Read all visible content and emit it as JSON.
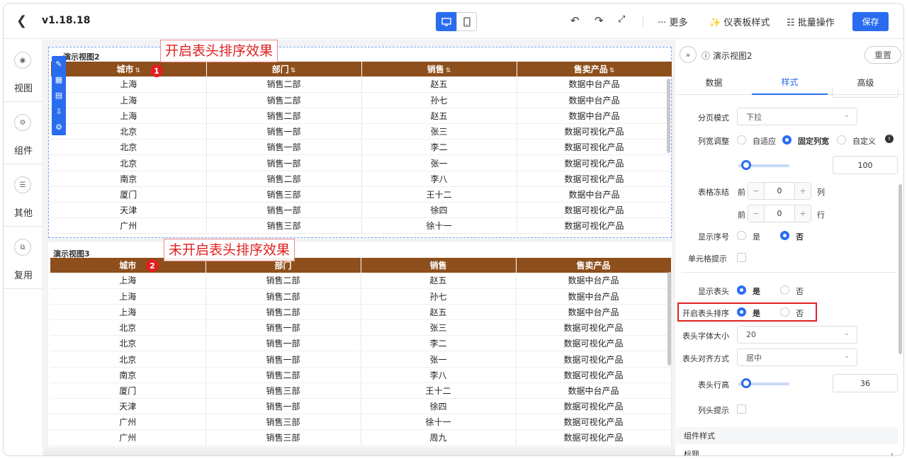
{
  "topbar": {
    "version": "v1.18.18",
    "more": "··· 更多",
    "dashboard_style": "仪表板样式",
    "batch_ops": "批量操作",
    "save": "保存"
  },
  "leftnav": {
    "items": [
      {
        "label": "视图"
      },
      {
        "label": "组件"
      },
      {
        "label": "其他"
      },
      {
        "label": "复用"
      }
    ]
  },
  "canvas": {
    "annotations": {
      "a1": "开启表头排序效果",
      "a2": "未开启表头排序效果",
      "n1": "1",
      "n2": "2"
    },
    "view1": {
      "title": "演示视图2",
      "columns": [
        "城市",
        "部门",
        "销售",
        "售卖产品"
      ],
      "sort_icon": "⇅",
      "rows": [
        [
          "上海",
          "销售二部",
          "赵五",
          "数据中台产品"
        ],
        [
          "上海",
          "销售二部",
          "孙七",
          "数据中台产品"
        ],
        [
          "上海",
          "销售二部",
          "赵五",
          "数据中台产品"
        ],
        [
          "北京",
          "销售一部",
          "张三",
          "数据可视化产品"
        ],
        [
          "北京",
          "销售一部",
          "李二",
          "数据可视化产品"
        ],
        [
          "北京",
          "销售一部",
          "张一",
          "数据可视化产品"
        ],
        [
          "南京",
          "销售二部",
          "李八",
          "数据可视化产品"
        ],
        [
          "厦门",
          "销售三部",
          "王十二",
          "数据中台产品"
        ],
        [
          "天津",
          "销售一部",
          "徐四",
          "数据可视化产品"
        ],
        [
          "广州",
          "销售三部",
          "徐十一",
          "数据可视化产品"
        ]
      ]
    },
    "view2": {
      "title": "演示视图3",
      "columns": [
        "城市",
        "部门",
        "销售",
        "售卖产品"
      ],
      "rows": [
        [
          "上海",
          "销售二部",
          "赵五",
          "数据中台产品"
        ],
        [
          "上海",
          "销售二部",
          "孙七",
          "数据中台产品"
        ],
        [
          "上海",
          "销售二部",
          "赵五",
          "数据中台产品"
        ],
        [
          "北京",
          "销售一部",
          "张三",
          "数据可视化产品"
        ],
        [
          "北京",
          "销售一部",
          "李二",
          "数据可视化产品"
        ],
        [
          "北京",
          "销售一部",
          "张一",
          "数据可视化产品"
        ],
        [
          "南京",
          "销售二部",
          "李八",
          "数据可视化产品"
        ],
        [
          "厦门",
          "销售三部",
          "王十二",
          "数据中台产品"
        ],
        [
          "天津",
          "销售一部",
          "徐四",
          "数据可视化产品"
        ],
        [
          "广州",
          "销售三部",
          "徐十一",
          "数据可视化产品"
        ],
        [
          "广州",
          "销售三部",
          "周九",
          "数据可视化产品"
        ]
      ]
    }
  },
  "rpanel": {
    "title": "演示视图2",
    "reset": "重置",
    "tabs": [
      "数据",
      "样式",
      "高级"
    ],
    "pagination_label": "分页模式",
    "pagination_value": "下拉",
    "colwidth_label": "列宽调整",
    "colwidth_options": [
      "自适应",
      "固定列宽",
      "自定义"
    ],
    "colwidth_value": "100",
    "freeze_label": "表格冻结",
    "freeze_before": "前",
    "freeze_col_value": "0",
    "freeze_col_unit": "列",
    "freeze_row_value": "0",
    "freeze_row_unit": "行",
    "show_index_label": "显示序号",
    "yes": "是",
    "no": "否",
    "cell_tip_label": "单元格提示",
    "show_header_label": "显示表头",
    "header_sort_label": "开启表头排序",
    "header_font_label": "表头字体大小",
    "header_font_value": "20",
    "header_align_label": "表头对齐方式",
    "header_align_value": "居中",
    "header_height_label": "表头行高",
    "header_height_value": "36",
    "col_tip_label": "列头提示",
    "component_style": "组件样式",
    "title_section": "标题"
  },
  "colors": {
    "accent": "#2a6cf0",
    "header_bg": "#8d4f1c",
    "annotation": "#e02020"
  }
}
